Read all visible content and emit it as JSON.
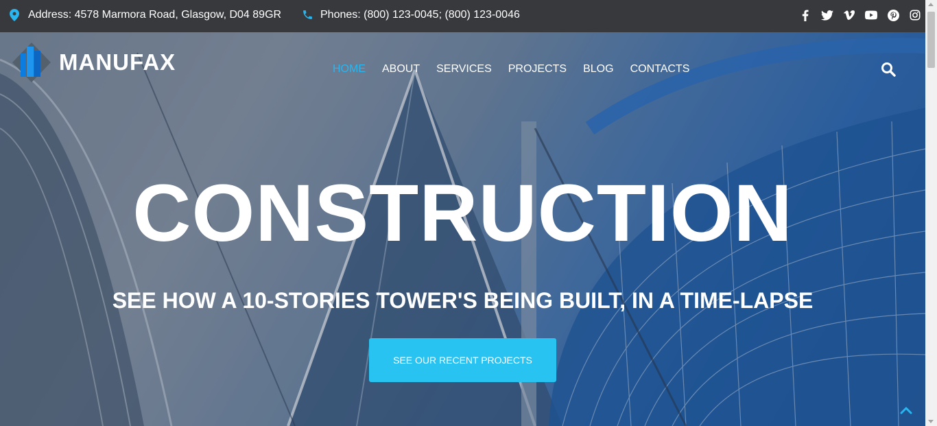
{
  "topbar": {
    "address": "Address: 4578 Marmora Road, Glasgow, D04 89GR",
    "phones": "Phones: (800) 123-0045; (800) 123-0046",
    "socials": [
      "facebook-icon",
      "twitter-icon",
      "vimeo-icon",
      "youtube-icon",
      "pinterest-icon",
      "instagram-icon"
    ]
  },
  "header": {
    "brand": "MANUFAX",
    "nav": [
      "HOME",
      "ABOUT",
      "SERVICES",
      "PROJECTS",
      "BLOG",
      "CONTACTS"
    ],
    "active_nav": "HOME"
  },
  "hero": {
    "headline": "CONSTRUCTION",
    "subline": "SEE HOW A 10-STORIES TOWER'S BEING BUILT, IN A TIME-LAPSE",
    "cta_label": "SEE OUR RECENT PROJECTS"
  },
  "colors": {
    "accent": "#29c3f2",
    "nav_active": "#29b6f0",
    "topbar_bg": "#38393d"
  }
}
